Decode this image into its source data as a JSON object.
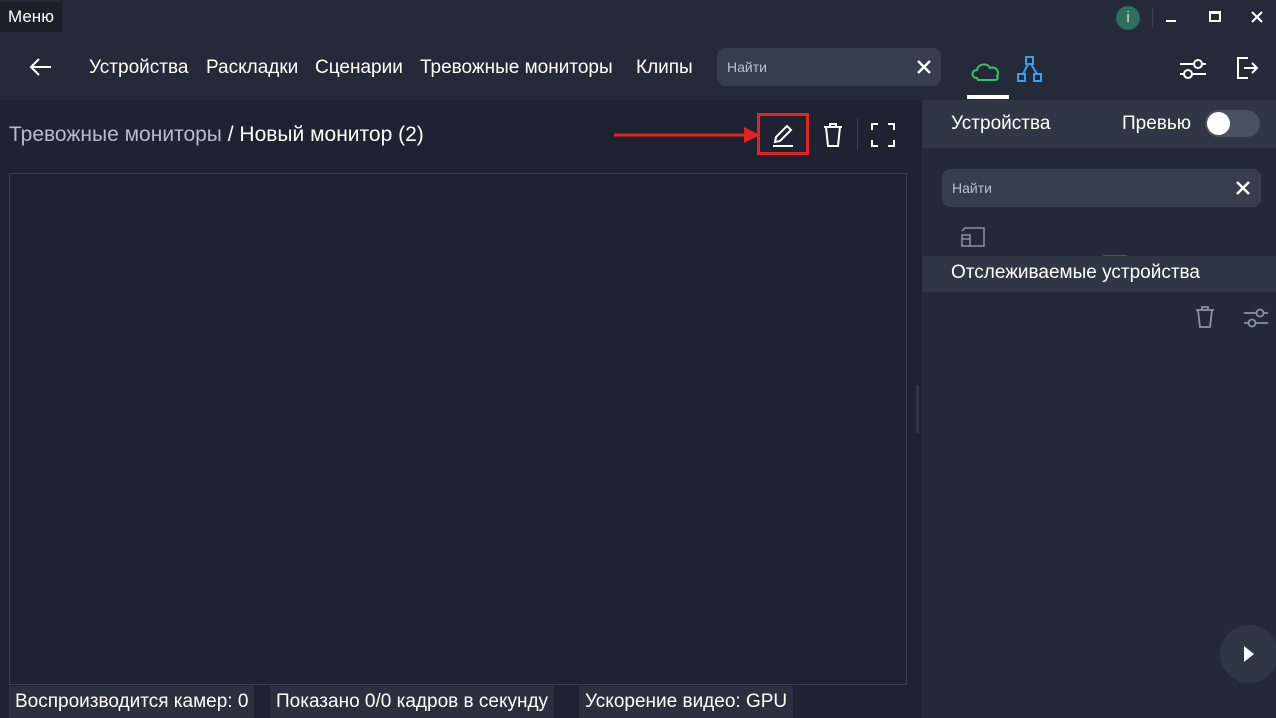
{
  "titlebar": {
    "menu_label": "Меню",
    "info_icon_glyph": "i",
    "info_color": "#2d6e5e"
  },
  "nav": {
    "tabs": [
      "Устройства",
      "Раскладки",
      "Сценарии",
      "Тревожные мониторы",
      "Клипы"
    ],
    "search_placeholder": "Найти",
    "cloud_color": "#35c26b",
    "nodes_color": "#3a9bf0"
  },
  "main": {
    "breadcrumb_parent": "Тревожные мониторы",
    "breadcrumb_separator": " / ",
    "breadcrumb_current": "Новый монитор (2)",
    "highlight_color": "#e32323"
  },
  "status": {
    "cameras": "Воспроизводится камер: 0",
    "frames": "Показано 0/0 кадров в секунду",
    "accel": "Ускорение видео: GPU"
  },
  "right_panel": {
    "title": "Устройства",
    "preview_label": "Превью",
    "preview_on": false,
    "search_placeholder": "Найти",
    "tracked_label": "Отслеживаемые устройства"
  }
}
